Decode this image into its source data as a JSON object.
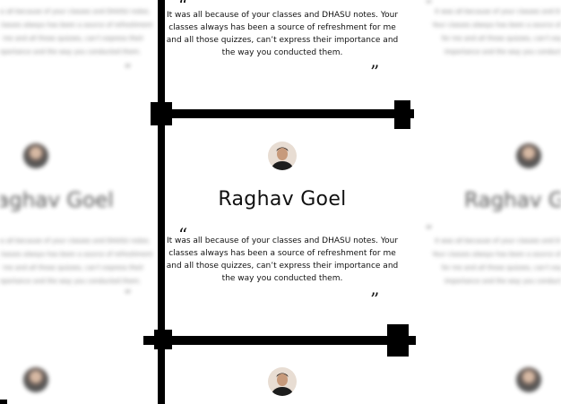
{
  "testimonial": {
    "name": "Raghav Goel",
    "quote": "It was all because of your classes and DHASU notes. Your classes always has been a source of refreshment for me and all those quizzes, can’t express their importance and the way you conducted them.",
    "open_quote": "“",
    "close_quote": "”"
  },
  "blurred": {
    "left_name": "aghav Goel",
    "right_name": "Raghav G",
    "snippet": "It was all because of your classes and DHASU notes. Your classes always has been a source of refreshment for me and all those quizzes, can’t express their importance and the way you conducted them.",
    "quote_mark": "“"
  },
  "colors": {
    "rail": "#000000",
    "text": "#111111",
    "background": "#ffffff"
  },
  "icons": {
    "avatar": "user-avatar-icon"
  }
}
